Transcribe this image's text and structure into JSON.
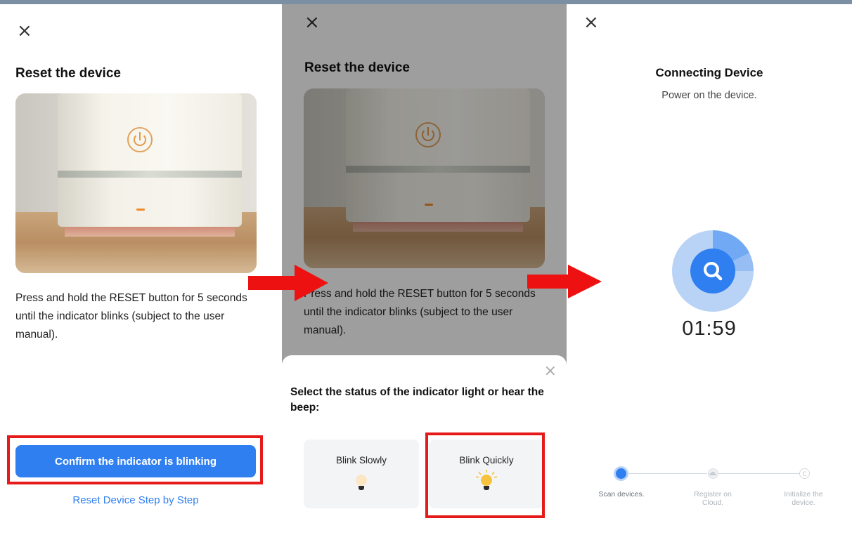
{
  "panel1": {
    "close": "×",
    "title": "Reset the device",
    "instruction": "Press and hold the RESET button for 5 seconds until the indicator blinks (subject to the user manual).",
    "confirm_button": "Confirm the indicator is blinking",
    "reset_link": "Reset Device Step by Step"
  },
  "panel2": {
    "close": "×",
    "title": "Reset the device",
    "instruction": "Press and hold the RESET button for 5 seconds until the indicator blinks (subject to the user manual).",
    "sheet": {
      "close": "×",
      "title": "Select the status of the indicator light or hear the beep:",
      "options": [
        {
          "label": "Blink Slowly",
          "icon": "bulb-dim-icon"
        },
        {
          "label": "Blink Quickly",
          "icon": "bulb-lit-icon"
        }
      ]
    }
  },
  "panel3": {
    "close": "×",
    "title": "Connecting Device",
    "subtitle": "Power on the device.",
    "timer": "01:59",
    "icon": "search-icon",
    "steps": [
      {
        "label": "Scan devices.",
        "state": "active"
      },
      {
        "label": "Register on Cloud.",
        "state": "pending"
      },
      {
        "label": "Initialize the device.",
        "state": "pending"
      }
    ]
  },
  "colors": {
    "accent": "#2f7ff0",
    "highlight_box": "#e51b1b",
    "arrow": "#ee1111"
  }
}
